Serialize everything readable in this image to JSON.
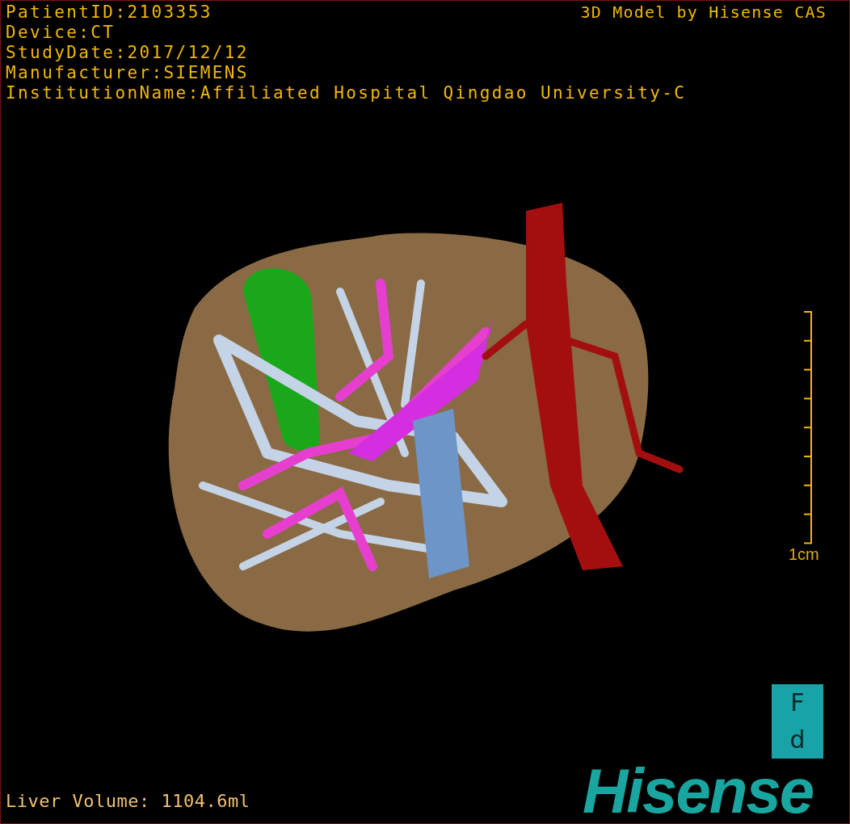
{
  "info_lines": [
    "PatientID:2103353",
    "Device:CT",
    "StudyDate:2017/12/12",
    "Manufacturer:SIEMENS",
    "InstitutionName:Affiliated Hospital Qingdao University-C"
  ],
  "title": "3D Model by Hisense CAS",
  "scale_bar": {
    "label": "1cm"
  },
  "orientation_marker": {
    "top": "F",
    "bottom": "d"
  },
  "liver_volume": "Liver Volume: 1104.6ml",
  "logo": "Hisense"
}
